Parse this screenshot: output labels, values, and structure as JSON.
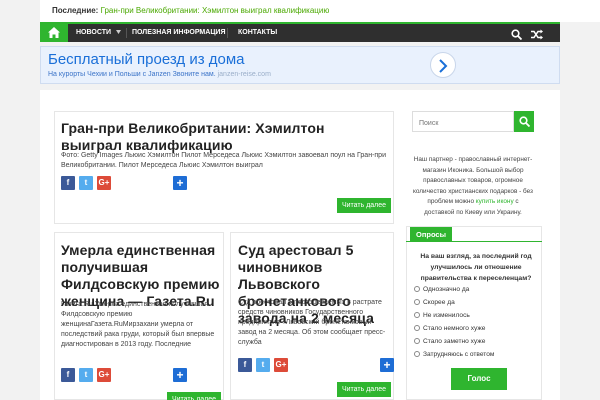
{
  "topbar": {
    "label": "Последние:",
    "headline": "Гран-при Великобритании: Хэмилтон выиграл квалификацию"
  },
  "nav": {
    "items": [
      "НОВОСТИ",
      "ПОЛЕЗНАЯ ИНФОРМАЦИЯ",
      "КОНТАКТЫ"
    ],
    "icons": [
      "home-icon",
      "chevron-down-icon",
      "search-icon",
      "shuffle-icon"
    ]
  },
  "ad": {
    "title": "Бесплатный проезд из дома",
    "text": "На курорты Чехии и Польши с Janzen Звоните нам.",
    "url": "janzen-reise.com"
  },
  "share": {
    "fb": "f",
    "tw": "t",
    "gp": "G+",
    "add": "+"
  },
  "articles": [
    {
      "title": "Гран-при Великобритании: Хэмилтон выиграл квалификацию",
      "excerpt": "Фото: Getty Images Льюис Хэмилтон Пилот Мерседеса Льюис Хэмилтон завоевал поул на Гран-при Великобритании. Пилот Мерседеса Льюис Хэмилтон выиграл",
      "read_more": "Читать далее"
    },
    {
      "title": "Умерла единственная получившая Филдсовскую премию женщина — Газета.Ru",
      "excerpt": "Газета.Ru Умерла единственная получившая Филдсовскую премию женщинаГазета.RuМирзахани умерла от последствий рака груди, который был впервые диагностирован в 2013 году. Последние",
      "read_more": "Читать далее"
    },
    {
      "title": "Суд арестовал 5 чиновников Львовского бронетанкового завода на 2 месяца",
      "excerpt": "Суд арестовал 5 подозреваемых в растрате средств чиновников Государственного предприятия «Львовский бронетанковый завод на 2 месяца. Об этом сообщает пресс-служба",
      "read_more": "Читать далее"
    }
  ],
  "sidebar": {
    "search_placeholder": "Поиск",
    "partner_text_1": "Наш партнер - православный интернет-магазин Иконика. Большой выбор православных товаров, огромное количество христианских подарков - без проблем можно",
    "partner_link": "купить икону",
    "partner_text_2": "с доставкой по Киеву или Украину."
  },
  "poll": {
    "title": "Опросы",
    "question": "На ваш взгляд, за последний год улучшилось ли отношение правительства к переселенцам?",
    "options": [
      "Однозначно да",
      "Скорее да",
      "Не изменилось",
      "Стало немного хуже",
      "Стало заметно хуже",
      "Затрудняюсь с ответом"
    ],
    "vote": "Голос"
  },
  "colors": {
    "accent": "#2fb52f",
    "navbar": "#2f2f2f",
    "ad_bg": "#e9f1fd",
    "ad_title": "#1a6fd8"
  }
}
